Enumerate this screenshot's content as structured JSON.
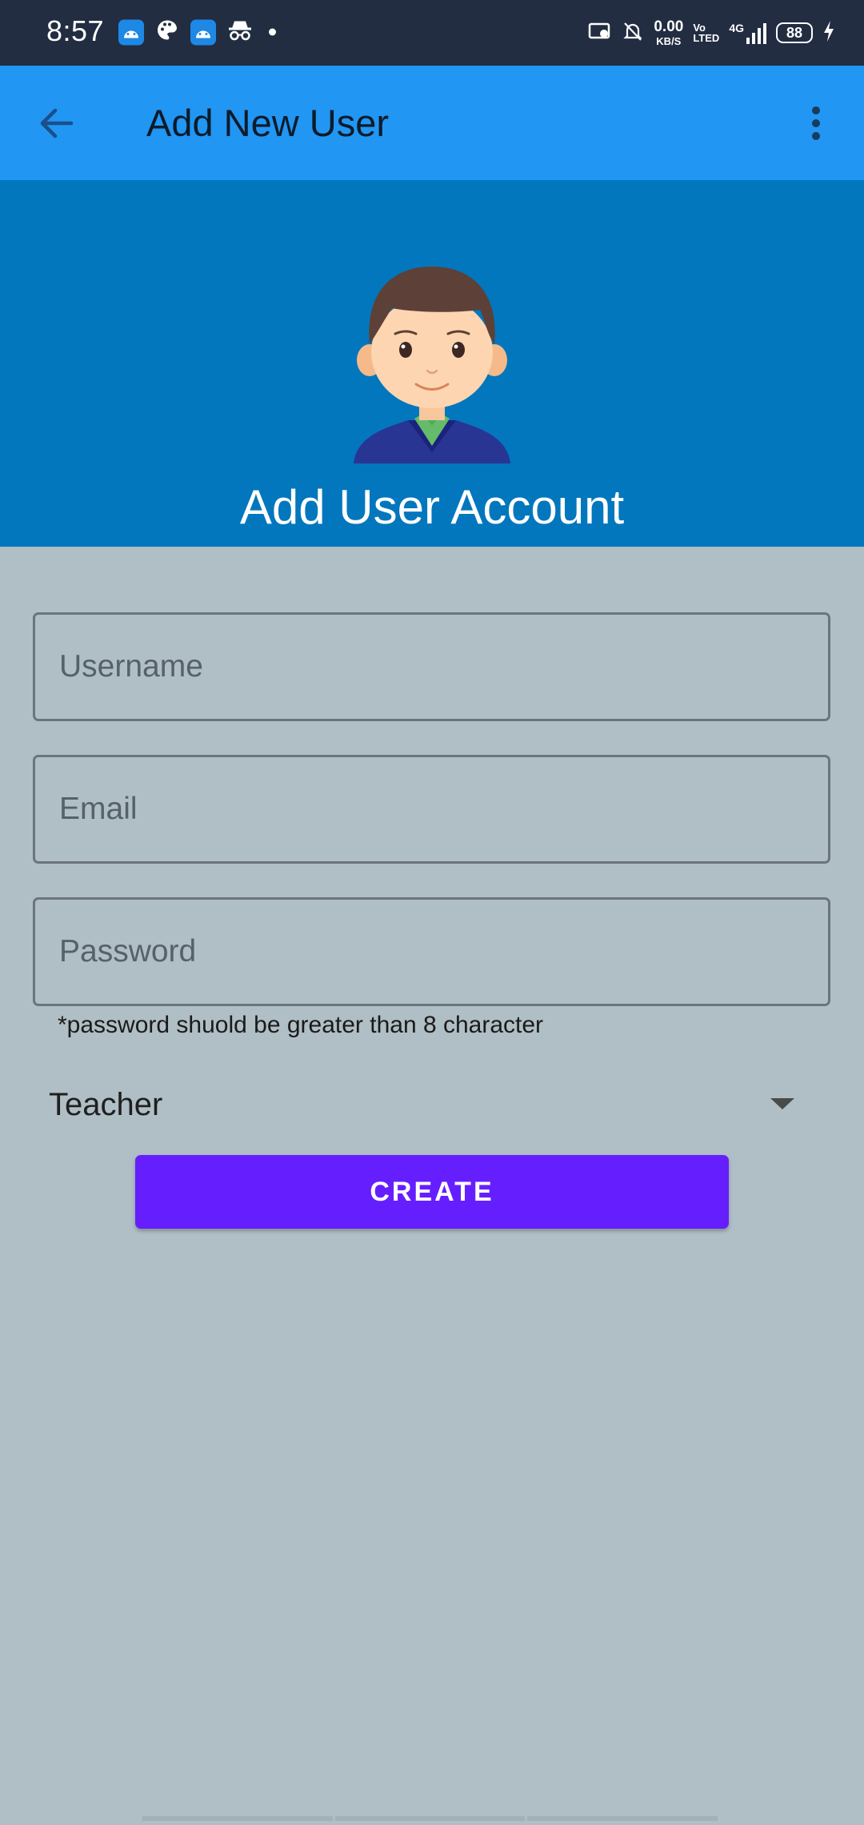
{
  "status_bar": {
    "time": "8:57",
    "net_speed_value": "0.00",
    "net_speed_unit": "KB/S",
    "volte_line1": "Vo",
    "volte_line2": "LTED",
    "network": "4G",
    "battery": "88",
    "icons": [
      "android-app-icon",
      "palette-icon",
      "android-app-icon",
      "incognito-icon",
      "dot-icon",
      "cast-icon",
      "bell-muted-icon",
      "signal-icon",
      "battery-icon",
      "charging-icon"
    ]
  },
  "app_bar": {
    "title": "Add New User",
    "color": "#2196f3"
  },
  "banner": {
    "title": "Add User Account",
    "color": "#0277bd"
  },
  "form": {
    "username_placeholder": "Username",
    "username_value": "",
    "email_placeholder": "Email",
    "email_value": "",
    "password_placeholder": "Password",
    "password_value": "",
    "password_hint": "*password shuold be greater than 8 character",
    "role_selected": "Teacher",
    "create_label": "CREATE",
    "create_color": "#651fff"
  },
  "colors": {
    "background": "#b0bec5",
    "status_bar": "#222d42"
  }
}
